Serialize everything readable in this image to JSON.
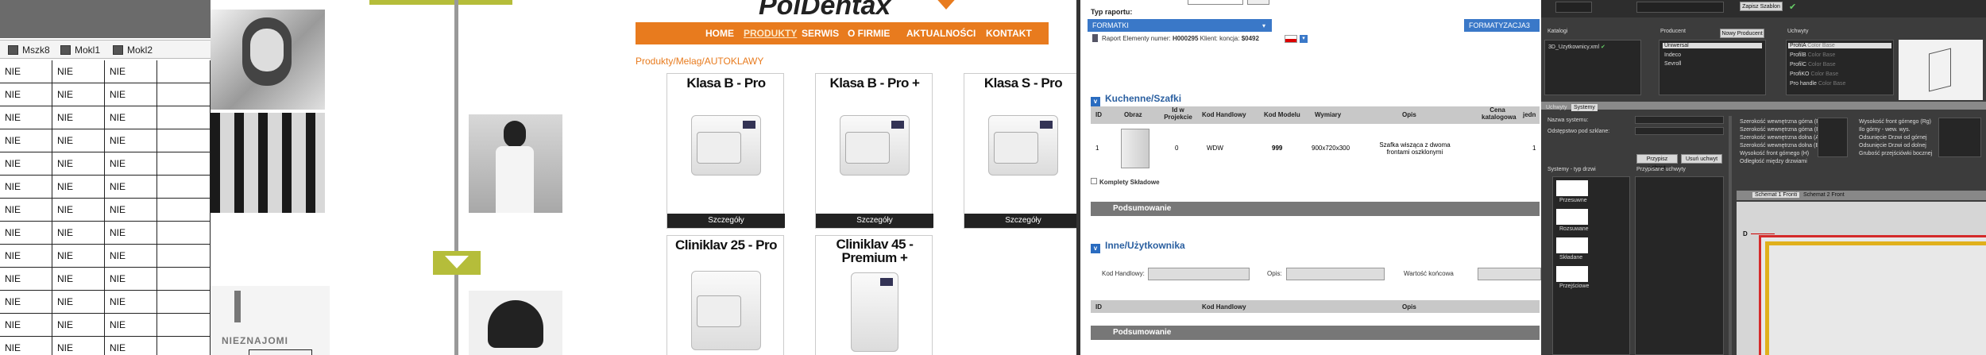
{
  "spreadsheet": {
    "columns": [
      "Mszk8",
      "Mokl1",
      "Mokl2"
    ],
    "cell_value": "NIE",
    "row_count": 13
  },
  "gallery": {
    "caption": "NIEZNAJOMI"
  },
  "shop": {
    "brand": "PolDentax",
    "nav": [
      "HOME",
      "PRODUKTY",
      "SERWIS",
      "O FIRMIE",
      "AKTUALNOŚCI",
      "KONTAKT"
    ],
    "breadcrumb": "Produkty/Melag/AUTOKLAWY",
    "products": [
      {
        "title": "Klasa B - Pro",
        "button": "Szczegóły"
      },
      {
        "title": "Klasa B - Pro +",
        "button": "Szczegóły"
      },
      {
        "title": "Klasa S - Pro",
        "button": "Szczegóły"
      },
      {
        "title": "Cliniklav 25 - Pro",
        "button": ""
      },
      {
        "title": "Cliniklav 45 - Premium +",
        "button": ""
      }
    ]
  },
  "report": {
    "type_label": "Typ raportu:",
    "format_left": "FORMATKI",
    "format_right": "FORMATYZACJA3",
    "info_prefix": "Raport Elementy numer:",
    "report_number": "H000295",
    "client_prefix": "Klient: koncja:",
    "client_number": "$0492",
    "section1": {
      "title": "Kuchenne/Szafki",
      "headers": [
        "ID",
        "Obraz",
        "Id w Projekcie",
        "Kod Handlowy",
        "Kod Modelu",
        "Wymiary",
        "Opis",
        "Cena katalogowa",
        "jedn"
      ],
      "row": {
        "id": "1",
        "project_id": "0",
        "trade_code": "WDW",
        "model_code": "999",
        "dims": "900x720x300",
        "desc": "Szafka wisząca z dwoma frontami oszklonymi"
      },
      "sub": "Komplety Składowe",
      "summary": "Podsumowanie"
    },
    "section2": {
      "title": "Inne/Użytkownika",
      "filter_code": "Kod Handlowy:",
      "filter_desc": "Opis:",
      "filter_value": "Wartość końcowa",
      "headers": [
        "ID",
        "Kod Handlowy",
        "Opis"
      ],
      "summary": "Podsumowanie"
    }
  },
  "designer": {
    "top_button": "Zapisz Szablon",
    "col_katalogi": "Katalogi",
    "col_producent": "Producent",
    "col_uchwyty": "Uchwyty",
    "new_producer": "Nowy Producent",
    "katalog_item": "3D_Uzytkownicy.xml",
    "producers": [
      "Uniwersal",
      "Indeco",
      "Sevroll"
    ],
    "handles": [
      {
        "name": "ProfilA",
        "sub": "Color Base"
      },
      {
        "name": "ProfilB",
        "sub": "Color Base"
      },
      {
        "name": "ProfilC",
        "sub": "Color Base"
      },
      {
        "name": "ProfiKO",
        "sub": "Color Base"
      },
      {
        "name": "Pro handle",
        "sub": "Color Base"
      }
    ],
    "tabs": [
      "Uchwyty",
      "Systemy"
    ],
    "name_label": "Nazwa systemu:",
    "gap_label": "Odstępstwo pod szklane:",
    "add_button": "Przypisz uchwyt",
    "remove_button": "Usuń uchwyt",
    "systems_label": "Systemy - typ drzwi",
    "assigned_label": "Przypisane uchwyty",
    "door_types": [
      "Przesuwne",
      "Rozsuwane",
      "Składane",
      "Przejściowe"
    ],
    "params": [
      "Szerokość wewnętrzna górna (Bg)",
      "Szerokość wewnętrzna górna (Bg)",
      "Szerokość wewnętrzna dolna (Ad)",
      "Szerokość wewnętrzna dolna (Bd)",
      "Wysokość front górnego (H)",
      "Odległość między drzwiami"
    ],
    "params_right": [
      "Wysokość front górnego (Rg)",
      "Ilo górny - wew. wys.",
      "Odsunięcie Drzwi od górnej",
      "Odsunięcie Drzwi od dolnej",
      "Grubość przejściówki bocznej"
    ],
    "preview_tabs": [
      "Schemat 1 Fronti",
      "Schemat 2 Front"
    ],
    "dim_label": "D"
  }
}
